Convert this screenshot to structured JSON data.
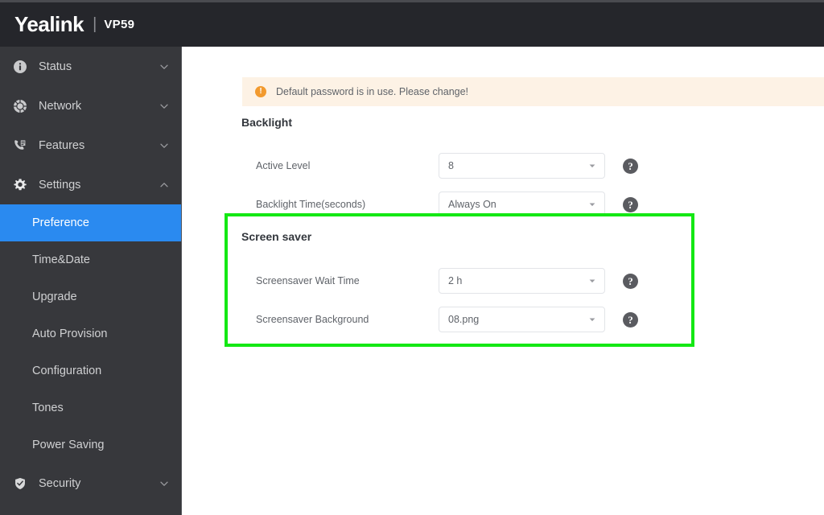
{
  "header": {
    "brand": "Yealink",
    "separator": "|",
    "model": "VP59"
  },
  "sidebar": {
    "groups": [
      {
        "label": "Status",
        "icon": "info-circle-icon",
        "chevron": "chevron-down-icon"
      },
      {
        "label": "Network",
        "icon": "network-globe-icon",
        "chevron": "chevron-down-icon"
      },
      {
        "label": "Features",
        "icon": "phone-features-icon",
        "chevron": "chevron-down-icon"
      },
      {
        "label": "Settings",
        "icon": "gear-icon",
        "chevron": "chevron-up-icon"
      }
    ],
    "settings_items": [
      {
        "label": "Preference",
        "active": true
      },
      {
        "label": "Time&Date",
        "active": false
      },
      {
        "label": "Upgrade",
        "active": false
      },
      {
        "label": "Auto Provision",
        "active": false
      },
      {
        "label": "Configuration",
        "active": false
      },
      {
        "label": "Tones",
        "active": false
      },
      {
        "label": "Power Saving",
        "active": false
      }
    ],
    "security": {
      "label": "Security",
      "icon": "shield-check-icon",
      "chevron": "chevron-down-icon"
    }
  },
  "alert": {
    "icon": "warning-icon",
    "symbol": "!",
    "text": "Default password is in use. Please change!"
  },
  "backlight": {
    "title": "Backlight",
    "fields": [
      {
        "label": "Active Level",
        "value": "8",
        "help": "?"
      },
      {
        "label": "Backlight Time(seconds)",
        "value": "Always On",
        "help": "?"
      }
    ]
  },
  "screensaver": {
    "title": "Screen saver",
    "fields": [
      {
        "label": "Screensaver Wait Time",
        "value": "2 h",
        "help": "?"
      },
      {
        "label": "Screensaver Background",
        "value": "08.png",
        "help": "?"
      }
    ]
  },
  "colors": {
    "header_bg": "#25262b",
    "sidebar_bg": "#37383c",
    "active_item": "#2a8af0",
    "highlight_border": "#14e814",
    "alert_bg": "#fdf2e5",
    "alert_accent": "#f29a2e"
  }
}
